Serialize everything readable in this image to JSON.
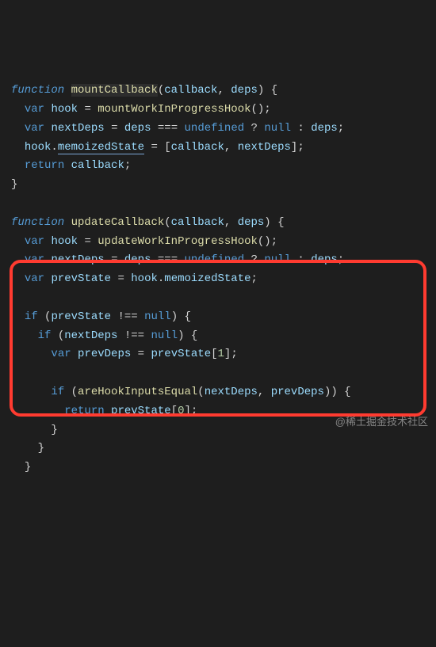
{
  "watermark": "@稀土掘金技术社区",
  "code": {
    "l01": {
      "kw_function": "function",
      "fn_name": "mountCallback",
      "p1": "callback",
      "p2": "deps"
    },
    "l02": {
      "kw_var": "var",
      "v": "hook",
      "call": "mountWorkInProgressHook"
    },
    "l03": {
      "kw_var": "var",
      "v": "nextDeps",
      "a": "deps",
      "cn_undef": "undefined",
      "cn_null": "null",
      "b": "deps"
    },
    "l04": {
      "obj": "hook",
      "prop": "memoizedState",
      "a": "callback",
      "b": "nextDeps"
    },
    "l05": {
      "kw_return": "return",
      "v": "callback"
    },
    "l08": {
      "kw_function": "function",
      "fn_name": "updateCallback",
      "p1": "callback",
      "p2": "deps"
    },
    "l09": {
      "kw_var": "var",
      "v": "hook",
      "call": "updateWorkInProgressHook"
    },
    "l10": {
      "kw_var": "var",
      "v": "nextDeps",
      "a": "deps",
      "cn_undef": "undefined",
      "cn_null": "null",
      "b": "deps"
    },
    "l11": {
      "kw_var": "var",
      "v": "prevState",
      "obj": "hook",
      "prop": "memoizedState"
    },
    "l13": {
      "kw_if": "if",
      "v": "prevState",
      "cn_null": "null"
    },
    "l14": {
      "kw_if": "if",
      "v": "nextDeps",
      "cn_null": "null"
    },
    "l15": {
      "kw_var": "var",
      "v": "prevDeps",
      "arr": "prevState",
      "idx": "1"
    },
    "l17": {
      "kw_if": "if",
      "call": "areHookInputsEqual",
      "a": "nextDeps",
      "b": "prevDeps"
    },
    "l18": {
      "kw_return": "return",
      "arr": "prevState",
      "idx": "0"
    }
  }
}
